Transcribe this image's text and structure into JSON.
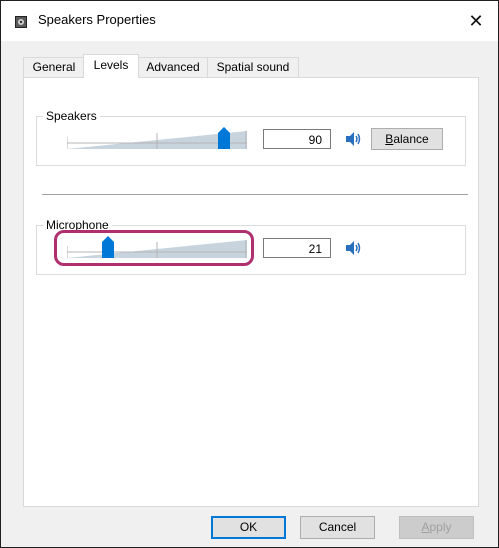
{
  "window": {
    "title": "Speakers Properties",
    "close_glyph": "✕"
  },
  "tabs": [
    {
      "label": "General",
      "active": false
    },
    {
      "label": "Levels",
      "active": true
    },
    {
      "label": "Advanced",
      "active": false
    },
    {
      "label": "Spatial sound",
      "active": false
    }
  ],
  "speakers": {
    "group_label": "Speakers",
    "level": 90,
    "level_text": "90",
    "mute_icon": "speaker-volume-icon",
    "balance_label_accel": "B",
    "balance_label_rest": "alance"
  },
  "microphone": {
    "group_label": "Microphone",
    "level": 21,
    "level_text": "21",
    "mute_icon": "speaker-volume-icon"
  },
  "footer": {
    "ok_label": "OK",
    "cancel_label": "Cancel",
    "apply_label_accel": "A",
    "apply_label_rest": "pply"
  },
  "colors": {
    "accent": "#0078d7",
    "highlight": "#b0306f",
    "slider_fill": "#c7d4de"
  }
}
